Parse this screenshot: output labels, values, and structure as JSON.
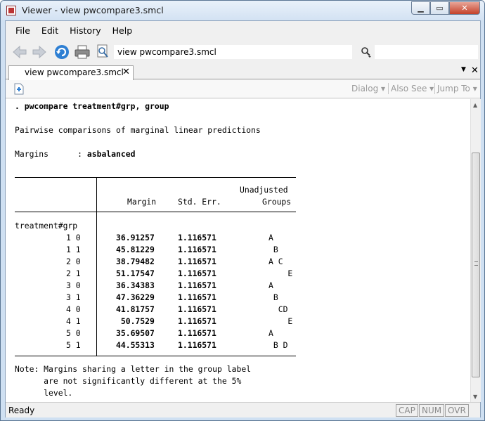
{
  "window": {
    "title": "Viewer - view pwcompare3.smcl"
  },
  "menu": [
    "File",
    "Edit",
    "History",
    "Help"
  ],
  "toolbar": {
    "url": "view pwcompare3.smcl",
    "search_value": ""
  },
  "tab": {
    "label": "view pwcompare3.smcl",
    "close": "✕"
  },
  "viewer_toolbar": {
    "dialog": "Dialog ▾",
    "also_see": "Also See ▾",
    "jump_to": "Jump To ▾"
  },
  "output": {
    "command": ". pwcompare treatment#grp, group",
    "heading": "Pairwise comparisons of marginal linear predictions",
    "margins_label": "Margins      : ",
    "margins_value": "asbalanced",
    "col_header_top": "Unadjusted",
    "col_margin": "Margin",
    "col_stderr": "Std. Err.",
    "col_groups": "Groups",
    "row_group_label": "treatment#grp",
    "rows": [
      {
        "label": "1 0",
        "margin": "36.91257",
        "se": "1.116571",
        "groups": "A"
      },
      {
        "label": "1 1",
        "margin": "45.81229",
        "se": "1.116571",
        "groups": " B"
      },
      {
        "label": "2 0",
        "margin": "38.79482",
        "se": "1.116571",
        "groups": "A C"
      },
      {
        "label": "2 1",
        "margin": "51.17547",
        "se": "1.116571",
        "groups": "    E"
      },
      {
        "label": "3 0",
        "margin": "36.34383",
        "se": "1.116571",
        "groups": "A"
      },
      {
        "label": "3 1",
        "margin": "47.36229",
        "se": "1.116571",
        "groups": " B"
      },
      {
        "label": "4 0",
        "margin": "41.81757",
        "se": "1.116571",
        "groups": "  CD"
      },
      {
        "label": "4 1",
        "margin": " 50.7529",
        "se": "1.116571",
        "groups": "    E"
      },
      {
        "label": "5 0",
        "margin": "35.69507",
        "se": "1.116571",
        "groups": "A"
      },
      {
        "label": "5 1",
        "margin": "44.55313",
        "se": "1.116571",
        "groups": " B D"
      }
    ],
    "note_lines": [
      "Note: Margins sharing a letter in the group label",
      "      are not significantly different at the 5%",
      "      level."
    ]
  },
  "status": {
    "text": "Ready",
    "cap": "CAP",
    "num": "NUM",
    "ovr": "OVR"
  }
}
